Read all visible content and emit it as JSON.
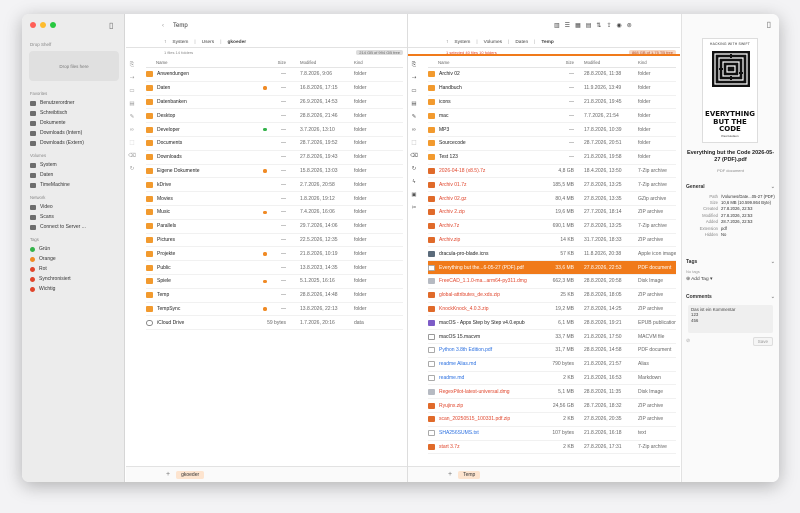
{
  "sidebar": {
    "drop_shelf_title": "Drop Shelf",
    "drop_shelf_hint": "Drop files here",
    "sections": [
      {
        "title": "Favorites",
        "items": [
          "Benutzerordner",
          "Schreibtisch",
          "Dokumente",
          "Downloads (Intern)",
          "Downloads (Extern)"
        ]
      },
      {
        "title": "Volumes",
        "items": [
          "System",
          "Daten",
          "TimeMachine"
        ]
      },
      {
        "title": "Network",
        "items": [
          "Video",
          "Scans",
          "Connect to Server ..."
        ]
      }
    ],
    "tags_title": "Tags",
    "tags": [
      {
        "label": "Grün",
        "color": "#33b34a"
      },
      {
        "label": "Orange",
        "color": "#f08a24"
      },
      {
        "label": "Rot",
        "color": "#e0452b"
      },
      {
        "label": "Synchronisiert",
        "color": "#e0452b"
      },
      {
        "label": "Wichtig",
        "color": "#e0452b"
      }
    ]
  },
  "left_pane": {
    "title": "Temp",
    "path": [
      "System",
      "Users",
      "gkoeder"
    ],
    "info": "1 files   14 folders",
    "free": "214 GB of 994 GB free",
    "columns": {
      "name": "Name",
      "size": "Size",
      "modified": "Modified",
      "kind": "Kind"
    },
    "rows": [
      {
        "name": "Anwendungen",
        "icon": "folder",
        "size": "—",
        "modified": "7.8.2026, 9:06",
        "kind": "folder",
        "tag": ""
      },
      {
        "name": "Daten",
        "icon": "folder",
        "size": "—",
        "modified": "16.8.2026, 17:15",
        "kind": "folder",
        "tag": "orange"
      },
      {
        "name": "Datenbanken",
        "icon": "folder",
        "size": "—",
        "modified": "26.9.2026, 14:53",
        "kind": "folder",
        "tag": ""
      },
      {
        "name": "Desktop",
        "icon": "folder",
        "size": "—",
        "modified": "28.8.2026, 21:46",
        "kind": "folder",
        "tag": ""
      },
      {
        "name": "Developer",
        "icon": "folder",
        "size": "—",
        "modified": "3.7.2026, 13:10",
        "kind": "folder",
        "tag": "green"
      },
      {
        "name": "Documents",
        "icon": "folder",
        "size": "—",
        "modified": "28.7.2026, 19:52",
        "kind": "folder",
        "tag": ""
      },
      {
        "name": "Downloads",
        "icon": "folder",
        "size": "—",
        "modified": "27.8.2026, 19:43",
        "kind": "folder",
        "tag": ""
      },
      {
        "name": "Eigene Dokumente",
        "icon": "folder",
        "size": "—",
        "modified": "15.8.2026, 13:03",
        "kind": "folder",
        "tag": "orange"
      },
      {
        "name": "kDrive",
        "icon": "folder",
        "size": "—",
        "modified": "2.7.2026, 20:58",
        "kind": "folder",
        "tag": ""
      },
      {
        "name": "Movies",
        "icon": "folder",
        "size": "—",
        "modified": "1.8.2026, 19:12",
        "kind": "folder",
        "tag": ""
      },
      {
        "name": "Music",
        "icon": "folder",
        "size": "—",
        "modified": "7.4.2026, 16:06",
        "kind": "folder",
        "tag": "orange"
      },
      {
        "name": "Parallels",
        "icon": "folder",
        "size": "—",
        "modified": "29.7.2026, 14:06",
        "kind": "folder",
        "tag": ""
      },
      {
        "name": "Pictures",
        "icon": "folder",
        "size": "—",
        "modified": "22.5.2026, 12:35",
        "kind": "folder",
        "tag": ""
      },
      {
        "name": "Projekte",
        "icon": "folder",
        "size": "—",
        "modified": "21.8.2026, 10:19",
        "kind": "folder",
        "tag": "orange"
      },
      {
        "name": "Public",
        "icon": "folder",
        "size": "—",
        "modified": "13.8.2023, 14:35",
        "kind": "folder",
        "tag": ""
      },
      {
        "name": "Spiele",
        "icon": "folder",
        "size": "—",
        "modified": "5.1.2025, 16:16",
        "kind": "folder",
        "tag": "orange"
      },
      {
        "name": "Temp",
        "icon": "folder",
        "size": "—",
        "modified": "28.8.2026, 14:48",
        "kind": "folder",
        "tag": ""
      },
      {
        "name": "TempSync",
        "icon": "folder",
        "size": "—",
        "modified": "13.8.2026, 22:13",
        "kind": "folder",
        "tag": "orange"
      },
      {
        "name": "iCloud Drive",
        "icon": "cloud",
        "size": "59 bytes",
        "modified": "1.7.2026, 20:16",
        "kind": "data",
        "tag": ""
      }
    ],
    "footer_tab": "gkoeder"
  },
  "right_pane": {
    "path": [
      "System",
      "Volumes",
      "Daten",
      "Temp"
    ],
    "info": "1 selected   40 files   10 folders",
    "free": "868 GB of 1.75 TB free",
    "columns": {
      "name": "Name",
      "size": "Size",
      "modified": "Modified",
      "kind": "Kind"
    },
    "rows": [
      {
        "name": "Archiv 02",
        "icon": "folder",
        "size": "—",
        "modified": "28.8.2026, 11:38",
        "kind": "folder",
        "style": ""
      },
      {
        "name": "Handbuch",
        "icon": "folder",
        "size": "—",
        "modified": "11.9.2026, 13:49",
        "kind": "folder",
        "style": ""
      },
      {
        "name": "icons",
        "icon": "folder",
        "size": "—",
        "modified": "21.8.2026, 19:45",
        "kind": "folder",
        "style": ""
      },
      {
        "name": "mac",
        "icon": "folder",
        "size": "—",
        "modified": "7.7.2026, 21:54",
        "kind": "folder",
        "style": ""
      },
      {
        "name": "MP3",
        "icon": "folder",
        "size": "—",
        "modified": "17.8.2026, 10:39",
        "kind": "folder",
        "style": ""
      },
      {
        "name": "Sourcecode",
        "icon": "folder",
        "size": "—",
        "modified": "28.7.2026, 20:51",
        "kind": "folder",
        "style": ""
      },
      {
        "name": "Test 123",
        "icon": "folder",
        "size": "—",
        "modified": "21.8.2026, 19:58",
        "kind": "folder",
        "style": ""
      },
      {
        "name": "2026-04-18 (x8.5).7z",
        "icon": "arch",
        "size": "4,8 GB",
        "modified": "18.4.2026, 13:50",
        "kind": "7-Zip archive",
        "style": "red"
      },
      {
        "name": "Archiv 01.7z",
        "icon": "arch",
        "size": "185,5 MB",
        "modified": "27.8.2026, 13:25",
        "kind": "7-Zip archive",
        "style": "red"
      },
      {
        "name": "Archiv 02.gz",
        "icon": "arch",
        "size": "80,4 MB",
        "modified": "27.8.2026, 13:35",
        "kind": "GZip archive",
        "style": "red"
      },
      {
        "name": "Archiv 2.zip",
        "icon": "arch",
        "size": "19,6 MB",
        "modified": "27.7.2026, 18:14",
        "kind": "ZIP archive",
        "style": "red"
      },
      {
        "name": "Archiv.7z",
        "icon": "arch",
        "size": "690,1 MB",
        "modified": "27.8.2026, 13:25",
        "kind": "7-Zip archive",
        "style": "red"
      },
      {
        "name": "Archiv.zip",
        "icon": "arch",
        "size": "14 KB",
        "modified": "31.7.2026, 18:33",
        "kind": "ZIP archive",
        "style": "red"
      },
      {
        "name": "dracula-pro-blade.icns",
        "icon": "img",
        "size": "57 KB",
        "modified": "11.8.2026, 20:38",
        "kind": "Apple icon image",
        "style": ""
      },
      {
        "name": "Everything but the...6-05-27 (PDF).pdf",
        "icon": "doc",
        "size": "33,6 MB",
        "modified": "27.8.2026, 22:53",
        "kind": "PDF document",
        "style": "sel"
      },
      {
        "name": "FreeCAD_1.1.0-ma...arm64-py311.dmg",
        "icon": "disk",
        "size": "662,3 MB",
        "modified": "28.8.2026, 20:58",
        "kind": "Disk Image",
        "style": "red"
      },
      {
        "name": "global-attributes_de.xds.zip",
        "icon": "arch",
        "size": "25 KB",
        "modified": "28.8.2026, 18:05",
        "kind": "ZIP archive",
        "style": "red"
      },
      {
        "name": "KnockKnock_4.0.3.zip",
        "icon": "arch",
        "size": "19,2 MB",
        "modified": "27.8.2026, 14:25",
        "kind": "ZIP archive",
        "style": "red"
      },
      {
        "name": "macOS - Apps Step by Step v4.0.epub",
        "icon": "epub",
        "size": "6,1 MB",
        "modified": "28.8.2026, 19:21",
        "kind": "EPUB publication",
        "style": ""
      },
      {
        "name": "macOS 15.macvm",
        "icon": "file",
        "size": "33,7 MB",
        "modified": "21.8.2026, 17:50",
        "kind": "MACVM file",
        "style": ""
      },
      {
        "name": "Python 3.8th Edition.pdf",
        "icon": "doc",
        "size": "31,7 MB",
        "modified": "28.8.2026, 14:58",
        "kind": "PDF document",
        "style": "blue"
      },
      {
        "name": "readme Alias.md",
        "icon": "doc",
        "size": "790 bytes",
        "modified": "21.8.2026, 21:57",
        "kind": "Alias",
        "style": "blue"
      },
      {
        "name": "readme.md",
        "icon": "doc",
        "size": "2 KB",
        "modified": "21.8.2026, 16:53",
        "kind": "Markdown",
        "style": "blue"
      },
      {
        "name": "RegexPilot-latest-universal.dmg",
        "icon": "disk",
        "size": "5,1 MB",
        "modified": "28.8.2026, 11:35",
        "kind": "Disk Image",
        "style": "red"
      },
      {
        "name": "Ryujinx.zip",
        "icon": "arch",
        "size": "24,56 GB",
        "modified": "28.7.2026, 18:32",
        "kind": "ZIP archive",
        "style": "red"
      },
      {
        "name": "scan_20250515_100331.pdf.zip",
        "icon": "arch",
        "size": "2 KB",
        "modified": "27.8.2026, 20:35",
        "kind": "ZIP archive",
        "style": "red"
      },
      {
        "name": "SHA256SUMS.txt",
        "icon": "doc",
        "size": "107 bytes",
        "modified": "21.8.2026, 16:18",
        "kind": "text",
        "style": "blue"
      },
      {
        "name": "start 3.7z",
        "icon": "arch",
        "size": "2 KB",
        "modified": "27.8.2026, 17:31",
        "kind": "7-Zip archive",
        "style": "red"
      }
    ],
    "footer_tab": "Temp"
  },
  "window_title": "Temp",
  "preview": {
    "book_top": "HACKING WITH SWIFT",
    "book_side": "CODE IS THE EASY PART. WHAT IS THE REST?",
    "book_big": "EVERYTHING BUT THE CODE",
    "book_author": "Paul Hudson",
    "title": "Everything but the Code 2026-05-27 (PDF).pdf",
    "subtitle": "PDF document",
    "general_title": "General",
    "general": [
      {
        "k": "Path",
        "v": "/Volumes/Date...05-27 (PDF).pdf"
      },
      {
        "k": "Size",
        "v": "10,6 MB (10.599.864 Byte)"
      },
      {
        "k": "Created",
        "v": "27.8.2026, 22:53"
      },
      {
        "k": "Modified",
        "v": "27.8.2026, 22:53"
      },
      {
        "k": "Added",
        "v": "28.7.2026, 22:53"
      },
      {
        "k": "Extension",
        "v": "pdf"
      },
      {
        "k": "Hidden",
        "v": "No"
      }
    ],
    "tags_title": "Tags",
    "no_tags": "No tags",
    "add_tag": "Add Tag",
    "comments_title": "Comments",
    "comment_text": "Das ist ein Kommentar\n123\n456",
    "save_label": "Save"
  }
}
